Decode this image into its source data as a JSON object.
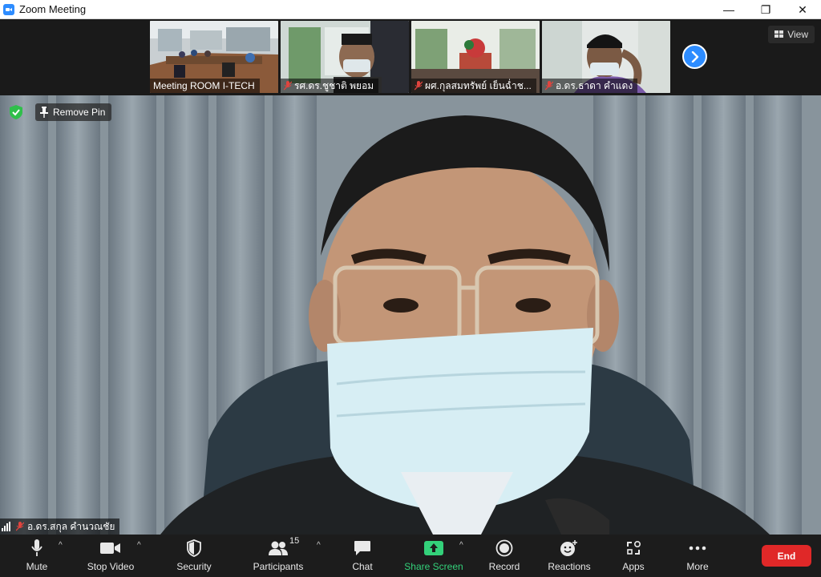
{
  "window": {
    "title": "Zoom Meeting",
    "minimize": "—",
    "maximize": "❐",
    "close": "✕"
  },
  "strip": {
    "thumbnails": [
      {
        "label": "Meeting ROOM I-TECH",
        "muted": false
      },
      {
        "label": "รศ.ดร.ชูชาติ  พยอม",
        "muted": true
      },
      {
        "label": "ผศ.กุลสมทรัพย์  เย็นฉ่ำช...",
        "muted": true
      },
      {
        "label": "อ.ดร.ธาดา  คำแดง",
        "muted": true
      }
    ],
    "view_label": "View"
  },
  "main": {
    "remove_pin_label": "Remove Pin",
    "speaker_name": "อ.ดร.สกุล  คำนวณชัย"
  },
  "toolbar": {
    "mute_label": "Mute",
    "stop_video_label": "Stop Video",
    "security_label": "Security",
    "participants_label": "Participants",
    "participants_count": "15",
    "chat_label": "Chat",
    "share_screen_label": "Share Screen",
    "record_label": "Record",
    "reactions_label": "Reactions",
    "apps_label": "Apps",
    "more_label": "More",
    "end_label": "End",
    "caret": "^"
  },
  "colors": {
    "accent": "#2d8cff",
    "share_green": "#33d17a",
    "end_red": "#e02828",
    "muted_red": "#e0443e",
    "shield_green": "#2fbf4a"
  }
}
